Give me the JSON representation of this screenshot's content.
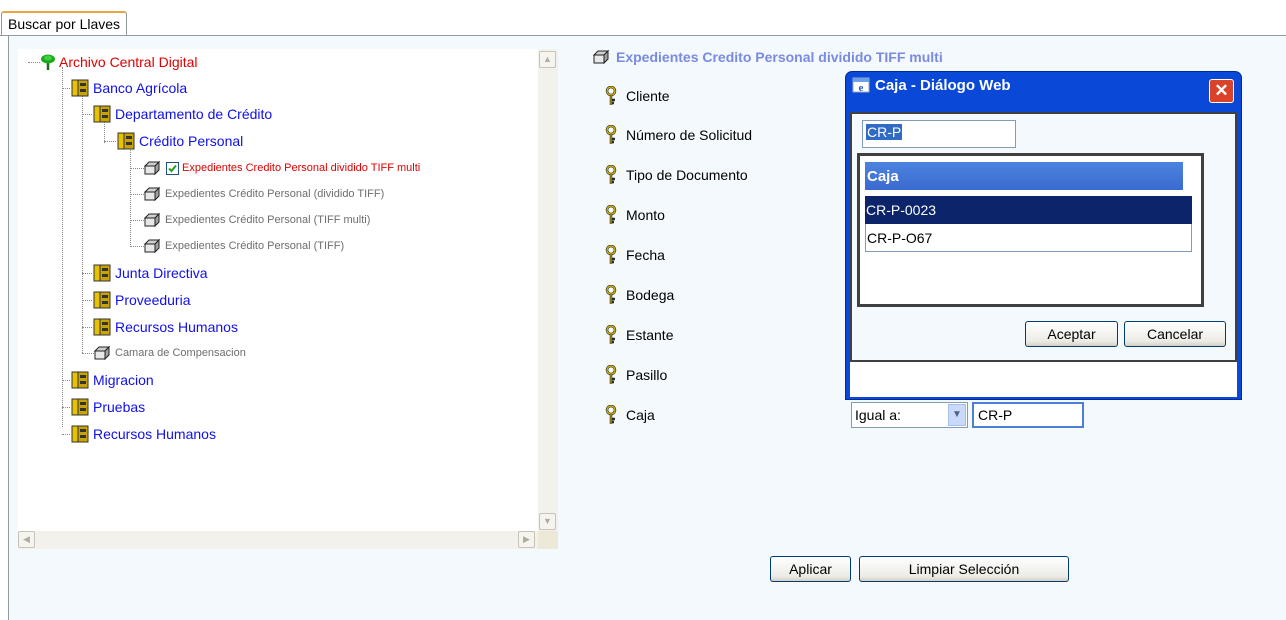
{
  "tab": {
    "label": "Buscar por Llaves"
  },
  "tree": {
    "root": "Archivo Central Digital",
    "banco": "Banco Agrícola",
    "departamento": "Departamento de Crédito",
    "credito_personal": "Crédito Personal",
    "exp1": "Expedientes Credito Personal dividido TIFF multi",
    "exp2": "Expedientes Crédito Personal (dividido TIFF)",
    "exp3": "Expedientes Crédito Personal (TIFF multi)",
    "exp4": "Expedientes Crédito Personal (TIFF)",
    "junta": "Junta Directiva",
    "proveeduria": "Proveeduria",
    "rrhh1": "Recursos Humanos",
    "camara": "Camara de Compensacion",
    "migracion": "Migracion",
    "pruebas": "Pruebas",
    "rrhh2": "Recursos Humanos"
  },
  "form": {
    "title": "Expedientes Credito Personal dividido TIFF multi",
    "fields": [
      "Cliente",
      "Número de Solicitud",
      "Tipo de Documento",
      "Monto",
      "Fecha",
      "Bodega",
      "Estante",
      "Pasillo",
      "Caja"
    ],
    "operator": "Igual a:",
    "caja_value": "CR-P",
    "apply_label": "Aplicar",
    "clear_label": "Limpiar Selección"
  },
  "dialog": {
    "title": "Caja - Diálogo Web",
    "close_glyph": "✕",
    "input_value": "CR-P",
    "list_header": "Caja",
    "items": [
      "CR-P-0023",
      "CR-P-O67"
    ],
    "accept_label": "Aceptar",
    "cancel_label": "Cancelar"
  },
  "colors": {
    "root": "#e00000",
    "folder": "#1010e8",
    "dialog_title": "#0a48d8",
    "selection": "#0b246a"
  },
  "icons": {
    "root": "tree-icon",
    "folder": "cabinet-icon",
    "document": "document-type-icon",
    "key": "key-icon",
    "checkbox": "checkbox-checked-icon"
  }
}
